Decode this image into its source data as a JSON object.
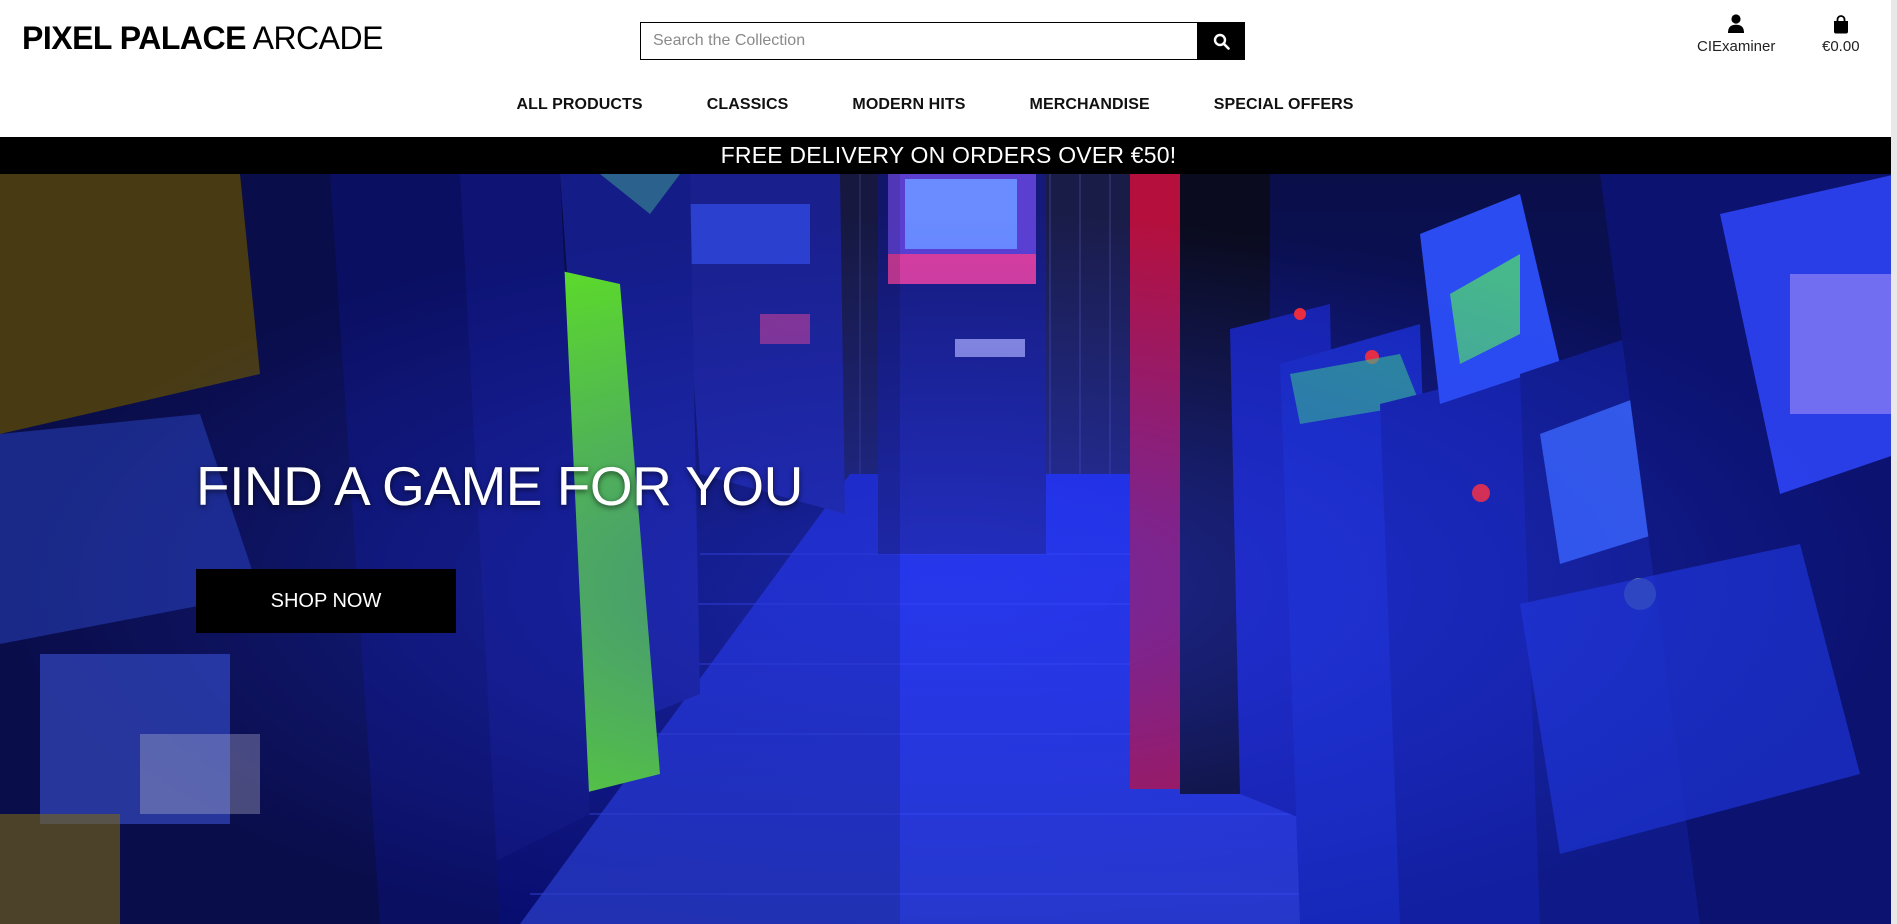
{
  "brand": {
    "bold": "PIXEL PALACE",
    "light": "ARCADE"
  },
  "search": {
    "placeholder": "Search the Collection",
    "icon": "search-icon"
  },
  "account": {
    "label": "CIExaminer",
    "icon": "user-icon"
  },
  "bag": {
    "total": "€0.00",
    "icon": "shopping-bag-icon"
  },
  "nav": {
    "items": [
      {
        "label": "ALL PRODUCTS"
      },
      {
        "label": "CLASSICS"
      },
      {
        "label": "MODERN HITS"
      },
      {
        "label": "MERCHANDISE"
      },
      {
        "label": "SPECIAL OFFERS"
      }
    ]
  },
  "banner": {
    "text": "FREE DELIVERY ON ORDERS OVER €50!"
  },
  "hero": {
    "title": "FIND A GAME FOR YOU",
    "button": "SHOP NOW",
    "image": "arcade-cabinets-photo"
  },
  "colors": {
    "accent": "#000000",
    "hero_tint": "#1a1fd6",
    "background": "#ffffff"
  }
}
